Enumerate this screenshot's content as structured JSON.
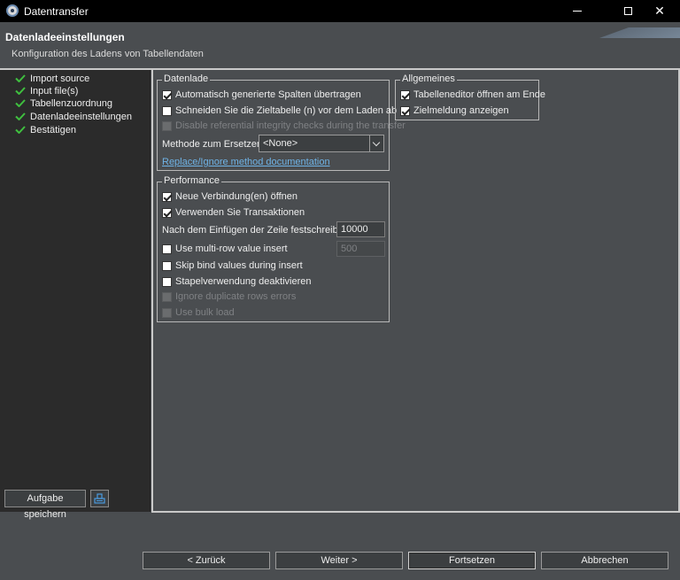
{
  "window": {
    "title": "Datentransfer"
  },
  "header": {
    "title": "Datenladeeinstellungen",
    "subtitle": "Konfiguration des Ladens von Tabellendaten"
  },
  "steps": [
    {
      "label": "Import source",
      "done": true
    },
    {
      "label": "Input file(s)",
      "done": true
    },
    {
      "label": "Tabellenzuordnung",
      "done": true
    },
    {
      "label": "Datenladeeinstellungen",
      "done": true
    },
    {
      "label": "Bestätigen",
      "done": true
    }
  ],
  "left_actions": {
    "save_task_label": "Aufgabe speichern"
  },
  "datenlade": {
    "legend": "Datenlade",
    "auto_columns": {
      "label": "Automatisch generierte Spalten übertragen",
      "checked": true
    },
    "truncate": {
      "label": "Schneiden Sie die Zieltabelle (n) vor dem Laden ab",
      "checked": false
    },
    "disable_ref": {
      "label": "Disable referential integrity checks during the transfer",
      "checked": false,
      "disabled": true
    },
    "replace_method_label": "Methode zum Ersetzen:",
    "replace_method_value": "<None>",
    "doc_link": "Replace/Ignore method documentation"
  },
  "allgemeines": {
    "legend": "Allgemeines",
    "open_editor": {
      "label": "Tabelleneditor öffnen am Ende",
      "checked": true
    },
    "show_notice": {
      "label": "Zielmeldung anzeigen",
      "checked": true
    }
  },
  "performance": {
    "legend": "Performance",
    "new_connection": {
      "label": "Neue Verbindung(en) öffnen",
      "checked": true
    },
    "use_transactions": {
      "label": "Verwenden Sie Transaktionen",
      "checked": true
    },
    "commit_label": "Nach dem Einfügen der Zeile festschreiben:",
    "commit_value": "10000",
    "multirow": {
      "label": "Use multi-row value insert",
      "checked": false
    },
    "multirow_value": "500",
    "skip_bind": {
      "label": "Skip bind values during insert",
      "checked": false
    },
    "disable_batch": {
      "label": "Stapelverwendung deaktivieren",
      "checked": false
    },
    "ignore_dup": {
      "label": "Ignore duplicate rows errors",
      "checked": false,
      "disabled": true
    },
    "bulk_load": {
      "label": "Use bulk load",
      "checked": false,
      "disabled": true
    }
  },
  "footer": {
    "back_label": "< Zurück",
    "next_label": "Weiter >",
    "continue_label": "Fortsetzen",
    "cancel_label": "Abbrechen"
  }
}
